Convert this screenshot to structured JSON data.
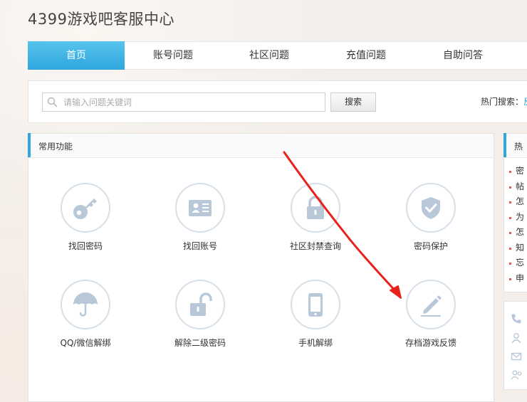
{
  "site": {
    "title": "4399游戏吧客服中心"
  },
  "nav": {
    "items": [
      {
        "label": "首页",
        "active": true
      },
      {
        "label": "账号问题",
        "active": false
      },
      {
        "label": "社区问题",
        "active": false
      },
      {
        "label": "充值问题",
        "active": false
      },
      {
        "label": "自助问答",
        "active": false
      }
    ]
  },
  "search": {
    "placeholder": "请输入问题关键词",
    "value": "",
    "button_label": "搜索",
    "hot_label": "热门搜索：",
    "hot_link": "反"
  },
  "panel": {
    "title": "常用功能",
    "functions": [
      {
        "label": "找回密码",
        "icon": "key-icon"
      },
      {
        "label": "找回账号",
        "icon": "id-card-icon"
      },
      {
        "label": "社区封禁查询",
        "icon": "lock-icon"
      },
      {
        "label": "密码保护",
        "icon": "shield-check-icon"
      },
      {
        "label": "QQ/微信解绑",
        "icon": "umbrella-icon"
      },
      {
        "label": "解除二级密码",
        "icon": "unlock-icon"
      },
      {
        "label": "手机解绑",
        "icon": "phone-icon"
      },
      {
        "label": "存档游戏反馈",
        "icon": "pencil-icon"
      }
    ]
  },
  "sidebar": {
    "title": "热",
    "items": [
      "密",
      "帖",
      "怎",
      "为",
      "怎",
      "知",
      "忘",
      "申"
    ]
  },
  "colors": {
    "accent": "#2fa6dd",
    "icon_stroke": "#b8c8d8",
    "annotation_arrow": "#e8211c"
  }
}
